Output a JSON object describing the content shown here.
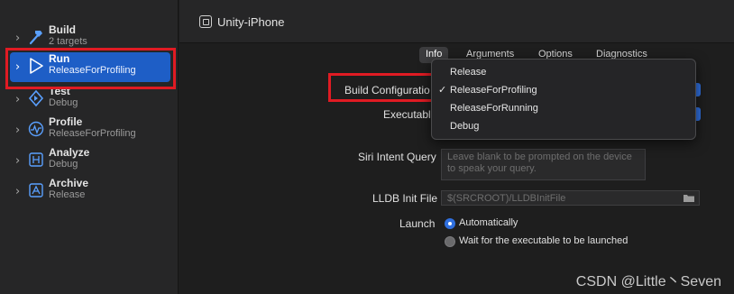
{
  "sidebar": {
    "items": [
      {
        "label": "Build",
        "sub": "2 targets",
        "icon": "hammer-icon"
      },
      {
        "label": "Run",
        "sub": "ReleaseForProfiling",
        "icon": "play-icon"
      },
      {
        "label": "Test",
        "sub": "Debug",
        "icon": "diamond-icon"
      },
      {
        "label": "Profile",
        "sub": "ReleaseForProfiling",
        "icon": "gauge-icon"
      },
      {
        "label": "Analyze",
        "sub": "Debug",
        "icon": "analyze-icon"
      },
      {
        "label": "Archive",
        "sub": "Release",
        "icon": "archive-icon"
      }
    ],
    "chevron": "›"
  },
  "header": {
    "title": "Unity-iPhone"
  },
  "tabs": [
    "Info",
    "Arguments",
    "Options",
    "Diagnostics"
  ],
  "form": {
    "build_configuration_label": "Build Configuratio",
    "executable_label": "Executable",
    "siri_label": "Siri Intent Query",
    "siri_placeholder": "Leave blank to be prompted on the device to speak your query.",
    "lldb_label": "LLDB Init File",
    "lldb_placeholder": "$(SRCROOT)/LLDBInitFile",
    "launch_label": "Launch",
    "launch_options": [
      "Automatically",
      "Wait for the executable to be launched"
    ],
    "launch_selected": "Automatically"
  },
  "menu": {
    "items": [
      "Release",
      "ReleaseForProfiling",
      "ReleaseForRunning",
      "Debug"
    ],
    "selected": "ReleaseForProfiling",
    "check": "✓"
  },
  "watermark": "CSDN @Little丶Seven",
  "colors": {
    "accent": "#2f6fde",
    "highlight_box": "#e01b23",
    "selection": "#1e5ec6"
  }
}
